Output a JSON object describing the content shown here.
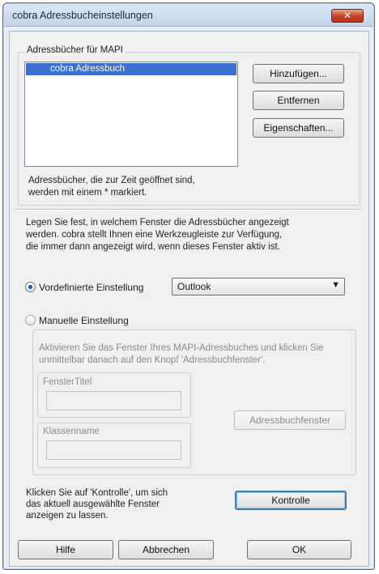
{
  "window": {
    "title": "cobra Adressbucheinstellungen",
    "close_glyph": "✕"
  },
  "mapi_group": {
    "label": "Adressbücher für MAPI",
    "list_items": [
      "cobra Adressbuch"
    ],
    "buttons": {
      "add": "Hinzufügen...",
      "remove": "Entfernen",
      "properties": "Eigenschaften..."
    },
    "note_line1": "Adressbücher, die zur Zeit geöffnet sind,",
    "note_line2": "werden mit einem * markiert."
  },
  "window_section": {
    "line1": "Legen Sie fest, in welchem Fenster die Adressbücher angezeigt",
    "line2": "werden. cobra stellt Ihnen eine Werkzeugleiste zur Verfügung,",
    "line3": "die immer dann angezeigt wird, wenn dieses Fenster aktiv ist."
  },
  "predefined": {
    "label": "Vordefinierte Einstellung",
    "selected": true,
    "combo_value": "Outlook"
  },
  "manual": {
    "label": "Manuelle Einstellung",
    "selected": false,
    "hint_line1": "Aktivieren Sie das Fenster Ihres MAPI-Adressbuches und klicken Sie",
    "hint_line2": "unmittelbar danach auf den Knopf 'Adressbuchfenster'.",
    "window_title_label": "FensterTitel",
    "window_title_value": "",
    "class_name_label": "Klassenname",
    "class_name_value": "",
    "address_window_button": "Adressbuchfenster"
  },
  "control": {
    "line1": "Klicken Sie auf 'Kontrolle', um sich",
    "line2": "das aktuell ausgewählte Fenster",
    "line3": "anzeigen zu lassen.",
    "button": "Kontrolle"
  },
  "footer": {
    "help": "Hilfe",
    "cancel": "Abbrechen",
    "ok": "OK"
  },
  "colors": {
    "selection": "#3b6fd1",
    "title_bar": "#c3d4ea",
    "close_button": "#c8452b",
    "focus_border": "#3c7fb1"
  },
  "icons": {
    "close": "close-icon",
    "dropdown": "chevron-down-icon",
    "radio_on": "radio-checked-icon",
    "radio_off": "radio-unchecked-icon"
  }
}
